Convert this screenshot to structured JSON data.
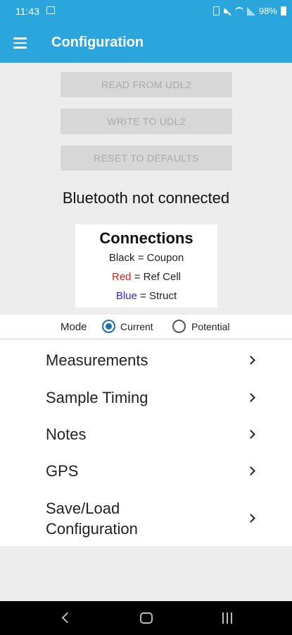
{
  "status_bar": {
    "time": "11:43",
    "battery": "98%"
  },
  "app_bar": {
    "title": "Configuration",
    "menu_icon": "hamburger-menu-icon"
  },
  "actions": {
    "read": "READ FROM UDL2",
    "write": "WRITE TO UDL2",
    "reset": "RESET TO DEFAULTS"
  },
  "bluetooth_status": "Bluetooth not connected",
  "connections": {
    "title": "Connections",
    "black_label": "Black",
    "black_value": "= Coupon",
    "red_label": "Red",
    "red_value": "= Ref Cell",
    "blue_label": "Blue",
    "blue_value": "= Struct",
    "colors": {
      "red": "#e02020",
      "blue": "#2a2ad8"
    }
  },
  "mode": {
    "label": "Mode",
    "options": [
      "Current",
      "Potential"
    ],
    "selected": "Current"
  },
  "menu": {
    "items": [
      {
        "label": "Measurements"
      },
      {
        "label": "Sample Timing"
      },
      {
        "label": "Notes"
      },
      {
        "label": "GPS"
      },
      {
        "label": "Save/Load Configuration"
      }
    ]
  },
  "colors": {
    "accent": "#2aa6dc",
    "radio": "#1d6fa8"
  }
}
